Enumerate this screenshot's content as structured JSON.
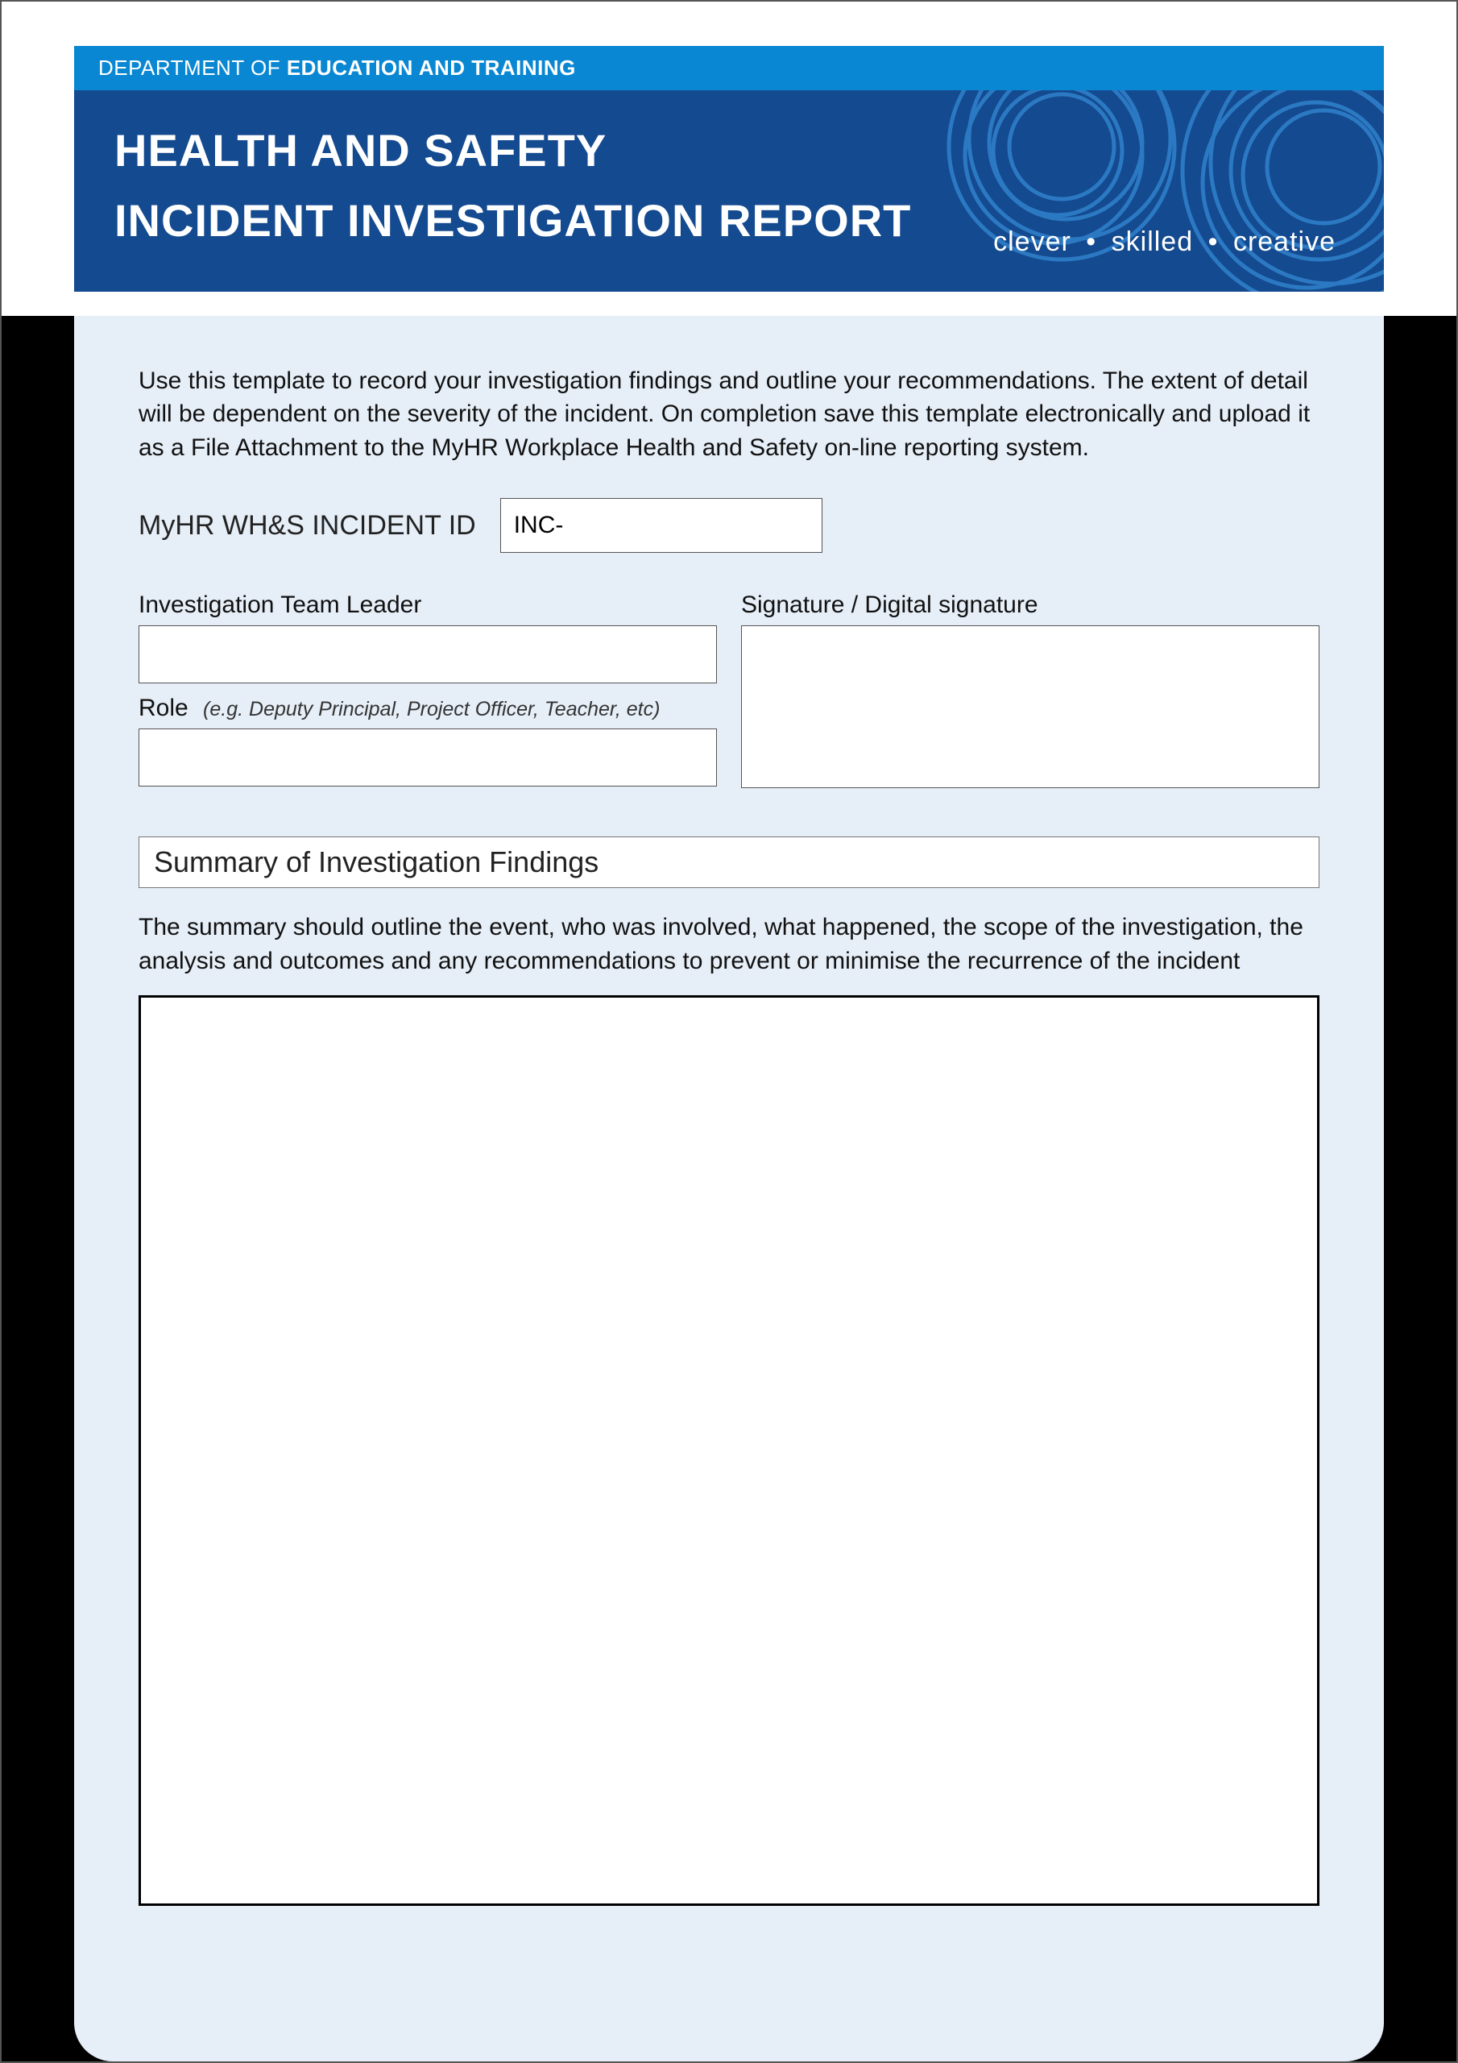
{
  "department": {
    "prefix": "DEPARTMENT OF ",
    "name": "EDUCATION AND TRAINING"
  },
  "header": {
    "title_line1": "HEALTH AND SAFETY",
    "title_line2": "INCIDENT INVESTIGATION REPORT",
    "tagline": {
      "word1": "clever",
      "word2": "skilled",
      "word3": "creative",
      "bullet": "•"
    }
  },
  "form": {
    "instructions": "Use this template to record your investigation findings and outline your recommendations. The extent of detail will be dependent on the severity of the incident. On completion save this template electronically and upload it as a File Attachment to the MyHR Workplace Health and Safety on-line reporting system.",
    "incident_id": {
      "label": "MyHR WH&S INCIDENT ID",
      "value": "INC-"
    },
    "team_leader": {
      "label": "Investigation Team Leader",
      "value": ""
    },
    "role": {
      "label": "Role",
      "hint": "(e.g. Deputy Principal, Project Officer, Teacher, etc)",
      "value": ""
    },
    "signature": {
      "label": "Signature / Digital signature"
    },
    "summary": {
      "heading": "Summary of Investigation Findings",
      "description": "The summary should outline the event, who was involved, what happened, the scope of the investigation, the analysis and outcomes and any recommendations to prevent or minimise the recurrence of the incident",
      "value": ""
    }
  }
}
